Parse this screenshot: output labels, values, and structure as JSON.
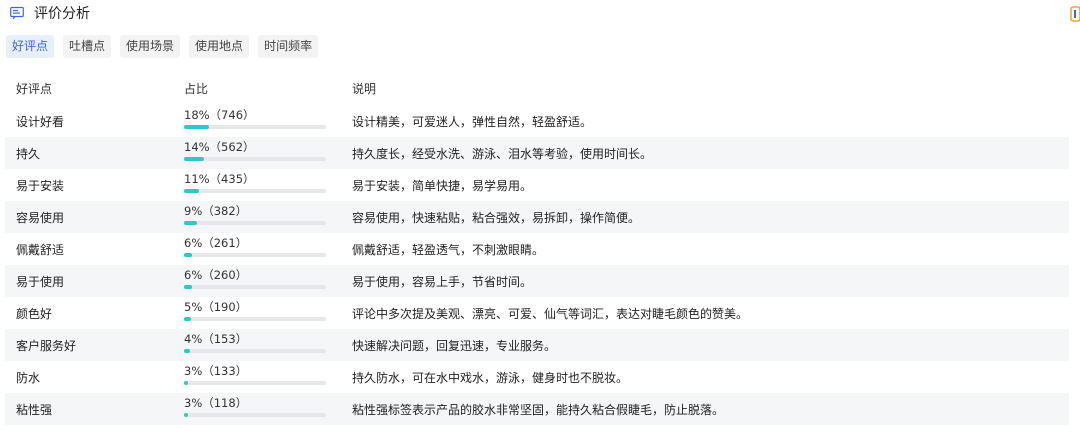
{
  "header": {
    "title": "评价分析",
    "icon": "review-chat-icon"
  },
  "tabs": [
    {
      "label": "好评点",
      "active": true
    },
    {
      "label": "吐槽点",
      "active": false
    },
    {
      "label": "使用场景",
      "active": false
    },
    {
      "label": "使用地点",
      "active": false
    },
    {
      "label": "时间频率",
      "active": false
    }
  ],
  "table": {
    "headers": {
      "point": "好评点",
      "ratio": "占比",
      "desc": "说明"
    },
    "rows": [
      {
        "point": "设计好看",
        "ratio": "18%（746）",
        "pct": 18,
        "desc": "设计精美，可爱迷人，弹性自然，轻盈舒适。"
      },
      {
        "point": "持久",
        "ratio": "14%（562）",
        "pct": 14,
        "desc": "持久度长，经受水洗、游泳、泪水等考验，使用时间长。"
      },
      {
        "point": "易于安装",
        "ratio": "11%（435）",
        "pct": 11,
        "desc": "易于安装，简单快捷，易学易用。"
      },
      {
        "point": "容易使用",
        "ratio": "9%（382）",
        "pct": 9,
        "desc": "容易使用，快速粘贴，粘合强效，易拆卸，操作简便。"
      },
      {
        "point": "佩戴舒适",
        "ratio": "6%（261）",
        "pct": 6,
        "desc": "佩戴舒适，轻盈透气，不刺激眼睛。"
      },
      {
        "point": "易于使用",
        "ratio": "6%（260）",
        "pct": 6,
        "desc": "易于使用，容易上手，节省时间。"
      },
      {
        "point": "颜色好",
        "ratio": "5%（190）",
        "pct": 5,
        "desc": "评论中多次提及美观、漂亮、可爱、仙气等词汇，表达对睫毛颜色的赞美。"
      },
      {
        "point": "客户服务好",
        "ratio": "4%（153）",
        "pct": 4,
        "desc": "快速解决问题，回复迅速，专业服务。"
      },
      {
        "point": "防水",
        "ratio": "3%（133）",
        "pct": 3,
        "desc": "持久防水，可在水中戏水，游泳，健身时也不脱妆。"
      },
      {
        "point": "粘性强",
        "ratio": "3%（118）",
        "pct": 3,
        "desc": "粘性强标签表示产品的胶水非常坚固，能持久粘合假睫毛，防止脱落。"
      }
    ]
  },
  "colors": {
    "accent": "#3b64e8",
    "bar": "#2fc7cf",
    "bar_track": "#e6e7ea",
    "alt_row": "#f5f6f8"
  }
}
